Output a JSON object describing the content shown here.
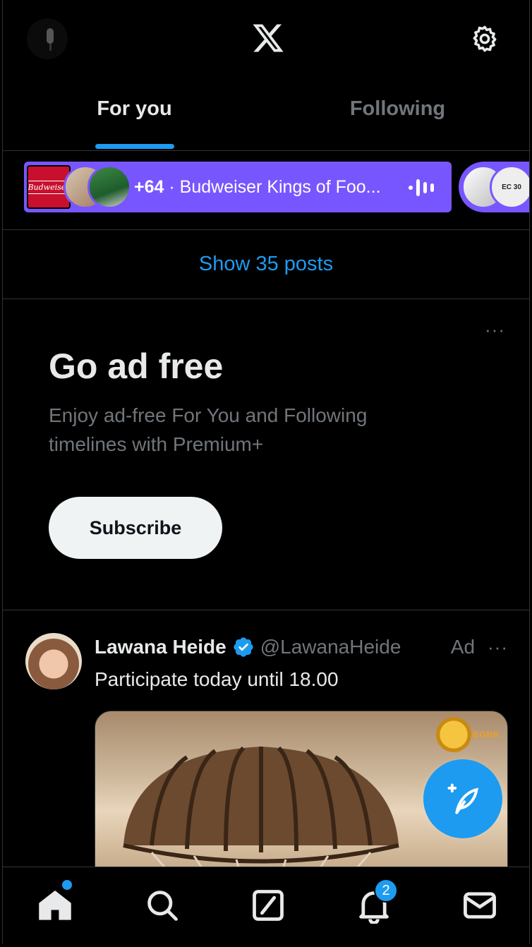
{
  "header": {
    "logo": "x-logo-icon",
    "settings_icon": "gear-icon"
  },
  "tabs": [
    {
      "label": "For you",
      "active": true
    },
    {
      "label": "Following",
      "active": false
    }
  ],
  "spaces": {
    "count": "+64",
    "separator": "·",
    "title": "Budweiser Kings of Foo...",
    "brand_mark": "Budweiser",
    "accent": "#7856ff",
    "second_avatar_text": "EC\n30"
  },
  "show_posts": {
    "label": "Show 35 posts"
  },
  "premium_card": {
    "title": "Go ad free",
    "description": "Enjoy ad-free For You and Following timelines with Premium+",
    "button": "Subscribe",
    "more": "···"
  },
  "ad_post": {
    "name": "Lawana Heide",
    "handle": "@LawanaHeide",
    "ad_label": "Ad",
    "more": "···",
    "text": "Participate today until 18.00",
    "media_brand": "BONK"
  },
  "nav": {
    "items": [
      "home-icon",
      "search-icon",
      "grok-icon",
      "notifications-icon",
      "messages-icon"
    ],
    "notification_count": "2"
  },
  "colors": {
    "accent": "#1d9bf0",
    "background": "#000000",
    "muted": "#71767b"
  }
}
